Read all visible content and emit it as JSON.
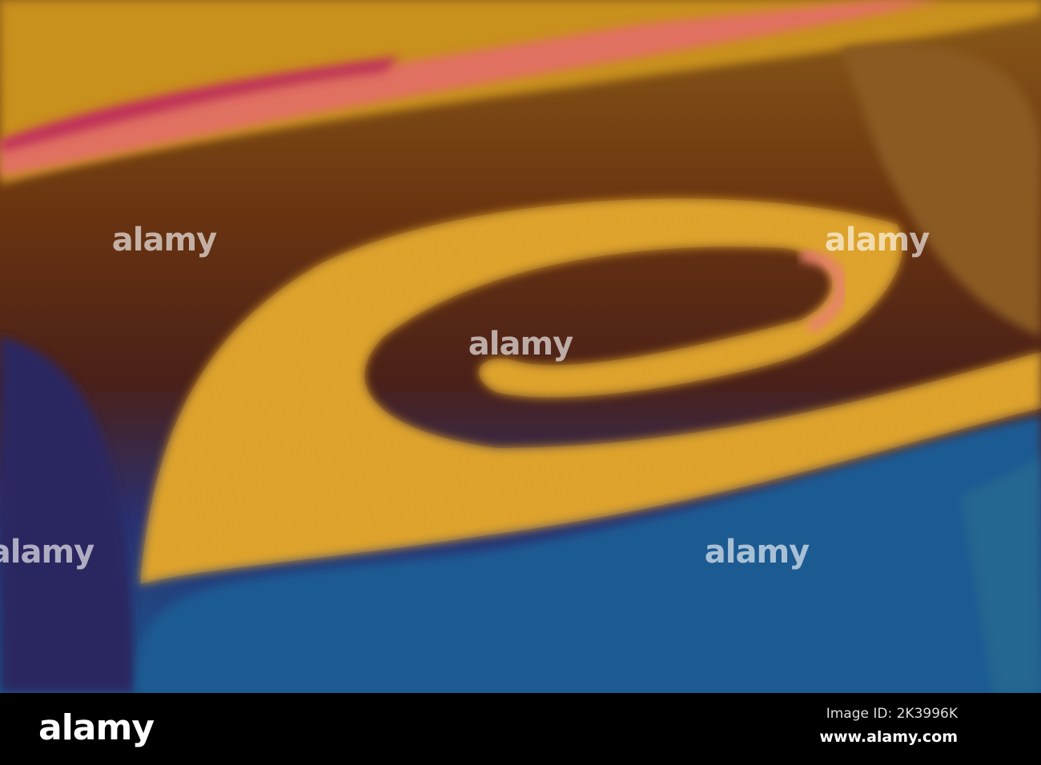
{
  "watermark": "alamy",
  "footer": {
    "logo": "alamy",
    "image_id": "Image ID: 2K3996K",
    "website": "www.alamy.com"
  },
  "colors": {
    "gold": "#e0a020",
    "brown": "#5a2a10",
    "blue": "#1a5a90",
    "pink": "#e06070"
  }
}
